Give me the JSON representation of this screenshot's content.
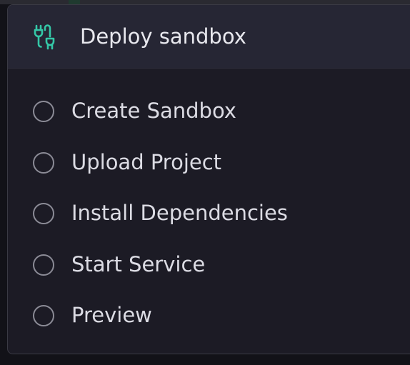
{
  "header": {
    "title": "Deploy sandbox",
    "icon": "plug-connector-icon",
    "icon_color": "#34c7a7"
  },
  "steps": [
    {
      "label": "Create Sandbox",
      "status": "pending"
    },
    {
      "label": "Upload Project",
      "status": "pending"
    },
    {
      "label": "Install Dependencies",
      "status": "pending"
    },
    {
      "label": "Start Service",
      "status": "pending"
    },
    {
      "label": "Preview",
      "status": "pending"
    }
  ],
  "colors": {
    "panel_bg": "#1c1b25",
    "header_bg": "#262634",
    "text": "#dcdce4",
    "circle": "#8b8b96"
  }
}
